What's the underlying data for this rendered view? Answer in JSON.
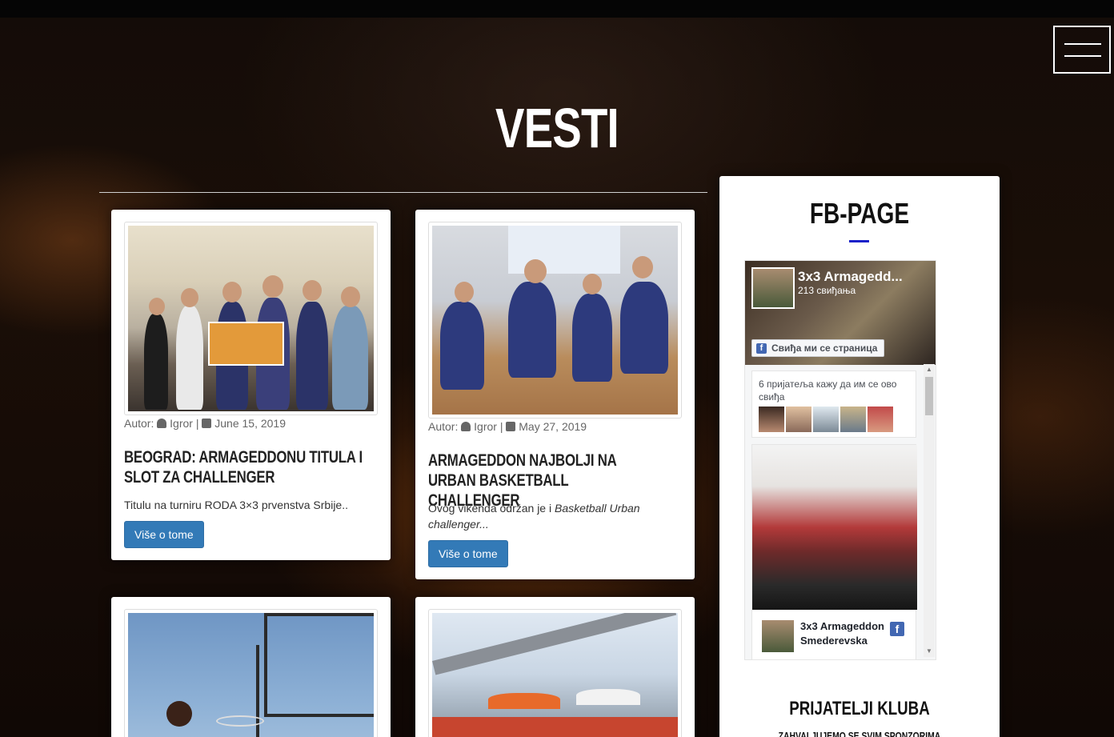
{
  "page": {
    "title": "VESTI"
  },
  "articles": [
    {
      "author_prefix": "Autor:",
      "author": "Igror",
      "separator": "|",
      "date": "June 15, 2019",
      "title": "BEOGRAD: ARMAGEDDONU TITULA I SLOT ZA CHALLENGER",
      "excerpt": "Titulu na turniru RODA 3×3 prvenstva Srbije..",
      "button": "Više o tome"
    },
    {
      "author_prefix": "Autor:",
      "author": "Igror",
      "separator": "|",
      "date": "May 27, 2019",
      "title": "ARMAGEDDON NAJBOLJI NA URBAN BASKETBALL CHALLENGER",
      "excerpt_plain": "Ovog vikenda održan je i ",
      "excerpt_italic": "Basketball Urban challenger...",
      "button": "Više o tome"
    }
  ],
  "sidebar": {
    "title": "FB-PAGE",
    "fb": {
      "page_name": "3x3 Armagedd...",
      "likes": "213 свиђања",
      "like_button": "Свиђа ми се страница",
      "friends_text": "6 пријатеља кажу да им се ово свиђа",
      "post_name": "3x3 Armageddon Smederevska"
    },
    "friends_title": "PRIJATELJI KLUBA",
    "friends_sub": "ZAHVALJUJEMO SE SVIM SPONZORIMA"
  },
  "colors": {
    "accent": "#1a21c9",
    "button": "#337ab7",
    "fb_blue": "#4267b2"
  }
}
